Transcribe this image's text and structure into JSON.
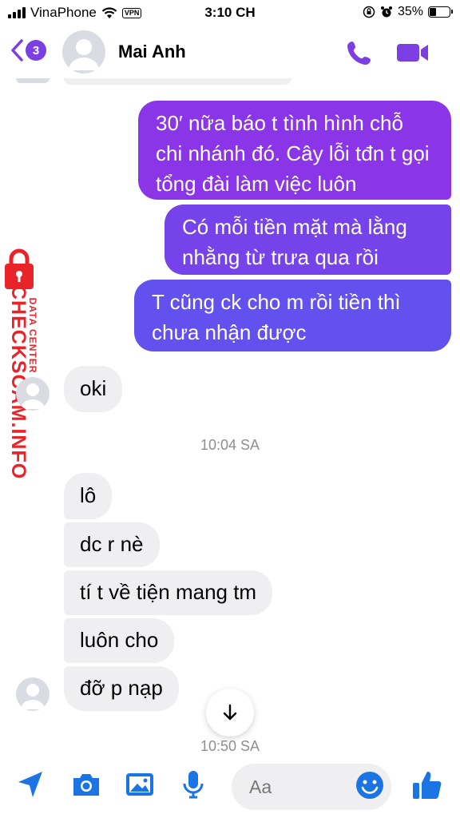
{
  "status_bar": {
    "carrier": "VinaPhone",
    "vpn": "VPN",
    "time": "3:10 CH",
    "battery": "35%",
    "battery_level": 0.35
  },
  "header": {
    "badge_count": "3",
    "contact_name": "Mai Anh"
  },
  "messages": {
    "sent_1": "30′ nữa báo t tình hình chỗ chi nhánh đó. Cây lỗi tđn t gọi tổng đài làm việc luôn",
    "sent_2": "Có mỗi tiền mặt mà lằng nhằng từ trưa qua rồi",
    "sent_3": "T cũng ck cho m rồi tiền thì chưa nhận được",
    "recv_1": "oki",
    "recv_2": "lô",
    "recv_3": "dc r nè",
    "recv_4": "tí t về tiện mang tm",
    "recv_5": "luôn cho",
    "recv_6": "đỡ p nạp"
  },
  "timestamps": {
    "t1": "10:04 SA",
    "t2": "10:50 SA"
  },
  "watermark": {
    "title": "CHECKSCAM.INFO",
    "subtitle": "DATA CENTER"
  },
  "composer": {
    "placeholder": "Aa"
  },
  "colors": {
    "accent": "#7b3fe4",
    "sent_top": "#8a35e8",
    "sent_bottom": "#5f52f0",
    "recv_bg": "#efeff1",
    "watermark_red": "#e8242a"
  }
}
